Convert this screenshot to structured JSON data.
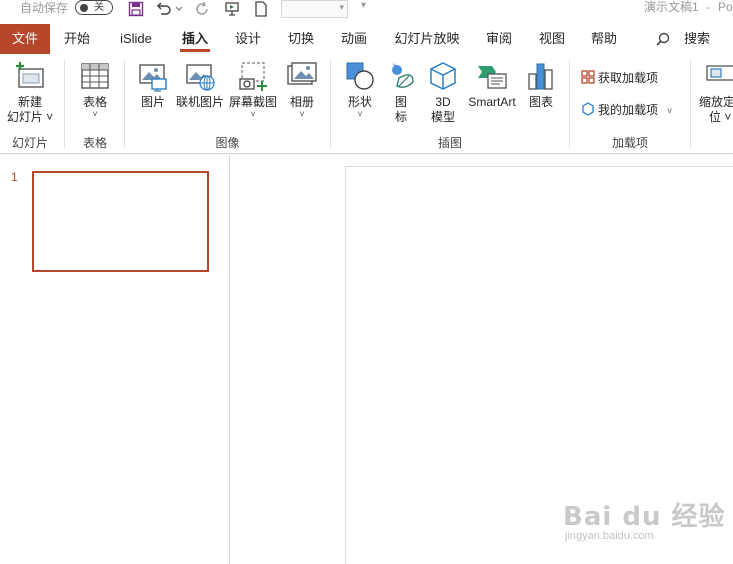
{
  "titlebar": {
    "autosave_label": "自动保存",
    "autosave_state": "关",
    "document_title": "演示文稿1",
    "separator": "-",
    "app_name_partial": "Po",
    "icons": [
      "save-icon",
      "undo-icon",
      "redo-icon",
      "present-icon",
      "new-file-icon",
      "customize-icon"
    ]
  },
  "tabs": {
    "file": "文件",
    "home": "开始",
    "islide": "iSlide",
    "insert": "插入",
    "design": "设计",
    "transitions": "切换",
    "animations": "动画",
    "slideshow": "幻灯片放映",
    "review": "审阅",
    "view": "视图",
    "help": "帮助",
    "search": "搜索",
    "active": "插入"
  },
  "ribbon": {
    "new_slide_line1": "新建",
    "new_slide_line2": "幻灯片",
    "group_slides": "幻灯片",
    "table": "表格",
    "group_tables": "表格",
    "pictures": "图片",
    "online_pictures": "联机图片",
    "screenshot": "屏幕截图",
    "album": "相册",
    "group_images": "图像",
    "shapes": "形状",
    "icons_line1": "图",
    "icons_line2": "标",
    "model3d_line1": "3D",
    "model3d_line2": "模型",
    "smartart": "SmartArt",
    "chart": "图表",
    "group_illustrations": "插图",
    "get_addins": "获取加载项",
    "my_addins": "我的加载项",
    "group_addins": "加载项",
    "zoom_line1": "缩放定",
    "zoom_line2": "位",
    "accent_color": "#b7472a"
  },
  "slides_panel": {
    "slide_number": "1"
  },
  "watermark": {
    "brand": "Bai du 经验",
    "url": "jingyan.baidu.com"
  }
}
